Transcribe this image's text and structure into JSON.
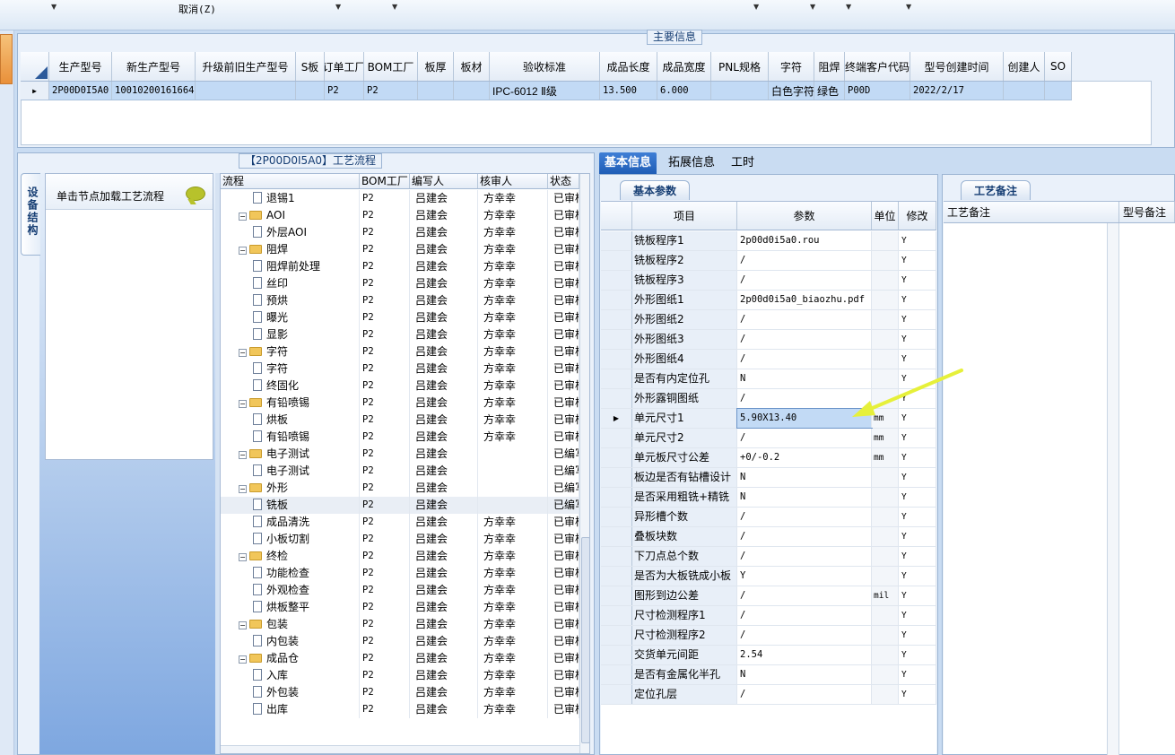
{
  "toolbar": {
    "cancel": "取消(Z)"
  },
  "main_info": {
    "title": "主要信息",
    "columns": [
      "生产型号",
      "新生产型号",
      "升级前旧生产型号",
      "S板",
      "订单工厂",
      "BOM工厂",
      "板厚",
      "板材",
      "验收标准",
      "成品长度",
      "成品宽度",
      "PNL规格",
      "字符",
      "阻焊",
      "终端客户代码",
      "型号创建时间",
      "创建人",
      "SO"
    ],
    "row": [
      "2P00D0I5A0",
      "10010200161664",
      "",
      "",
      "P2",
      "P2",
      "",
      "",
      "IPC-6012 Ⅱ级",
      "13.500",
      "6.000",
      "",
      "白色字符",
      "绿色",
      "P00D",
      "2022/2/17",
      "",
      ""
    ]
  },
  "left_panel": {
    "title": "【2P00D0I5A0】工艺流程",
    "vertical_tab": "设备结构",
    "node_hint": "单击节点加载工艺流程",
    "tree_columns": [
      "流程",
      "BOM工厂",
      "编写人",
      "核审人",
      "状态"
    ],
    "tree_rows": [
      {
        "name": "退锡1",
        "level": 1,
        "folder": false,
        "bom": "P2",
        "writer": "吕建会",
        "reviewer": "方幸幸",
        "status": "已审核"
      },
      {
        "name": "AOI",
        "level": 0,
        "folder": true,
        "bom": "P2",
        "writer": "吕建会",
        "reviewer": "方幸幸",
        "status": "已审核"
      },
      {
        "name": "外层AOI",
        "level": 1,
        "folder": false,
        "bom": "P2",
        "writer": "吕建会",
        "reviewer": "方幸幸",
        "status": "已审核"
      },
      {
        "name": "阻焊",
        "level": 0,
        "folder": true,
        "bom": "P2",
        "writer": "吕建会",
        "reviewer": "方幸幸",
        "status": "已审核"
      },
      {
        "name": "阻焊前处理",
        "level": 1,
        "folder": false,
        "bom": "P2",
        "writer": "吕建会",
        "reviewer": "方幸幸",
        "status": "已审核"
      },
      {
        "name": "丝印",
        "level": 1,
        "folder": false,
        "bom": "P2",
        "writer": "吕建会",
        "reviewer": "方幸幸",
        "status": "已审核"
      },
      {
        "name": "预烘",
        "level": 1,
        "folder": false,
        "bom": "P2",
        "writer": "吕建会",
        "reviewer": "方幸幸",
        "status": "已审核"
      },
      {
        "name": "曝光",
        "level": 1,
        "folder": false,
        "bom": "P2",
        "writer": "吕建会",
        "reviewer": "方幸幸",
        "status": "已审核"
      },
      {
        "name": "显影",
        "level": 1,
        "folder": false,
        "bom": "P2",
        "writer": "吕建会",
        "reviewer": "方幸幸",
        "status": "已审核"
      },
      {
        "name": "字符",
        "level": 0,
        "folder": true,
        "bom": "P2",
        "writer": "吕建会",
        "reviewer": "方幸幸",
        "status": "已审核"
      },
      {
        "name": "字符",
        "level": 1,
        "folder": false,
        "bom": "P2",
        "writer": "吕建会",
        "reviewer": "方幸幸",
        "status": "已审核"
      },
      {
        "name": "终固化",
        "level": 1,
        "folder": false,
        "bom": "P2",
        "writer": "吕建会",
        "reviewer": "方幸幸",
        "status": "已审核"
      },
      {
        "name": "有铅喷锡",
        "level": 0,
        "folder": true,
        "bom": "P2",
        "writer": "吕建会",
        "reviewer": "方幸幸",
        "status": "已审核"
      },
      {
        "name": "烘板",
        "level": 1,
        "folder": false,
        "bom": "P2",
        "writer": "吕建会",
        "reviewer": "方幸幸",
        "status": "已审核"
      },
      {
        "name": "有铅喷锡",
        "level": 1,
        "folder": false,
        "bom": "P2",
        "writer": "吕建会",
        "reviewer": "方幸幸",
        "status": "已审核"
      },
      {
        "name": "电子测试",
        "level": 0,
        "folder": true,
        "bom": "P2",
        "writer": "吕建会",
        "reviewer": "",
        "status": "已编写"
      },
      {
        "name": "电子测试",
        "level": 1,
        "folder": false,
        "bom": "P2",
        "writer": "吕建会",
        "reviewer": "",
        "status": "已编写"
      },
      {
        "name": "外形",
        "level": 0,
        "folder": true,
        "bom": "P2",
        "writer": "吕建会",
        "reviewer": "",
        "status": "已编写"
      },
      {
        "name": "铣板",
        "level": 1,
        "folder": false,
        "bom": "P2",
        "writer": "吕建会",
        "reviewer": "",
        "status": "已编写",
        "selected": true
      },
      {
        "name": "成品清洗",
        "level": 1,
        "folder": false,
        "bom": "P2",
        "writer": "吕建会",
        "reviewer": "方幸幸",
        "status": "已审核"
      },
      {
        "name": "小板切割",
        "level": 1,
        "folder": false,
        "bom": "P2",
        "writer": "吕建会",
        "reviewer": "方幸幸",
        "status": "已审核"
      },
      {
        "name": "终检",
        "level": 0,
        "folder": true,
        "bom": "P2",
        "writer": "吕建会",
        "reviewer": "方幸幸",
        "status": "已审核"
      },
      {
        "name": "功能检查",
        "level": 1,
        "folder": false,
        "bom": "P2",
        "writer": "吕建会",
        "reviewer": "方幸幸",
        "status": "已审核"
      },
      {
        "name": "外观检查",
        "level": 1,
        "folder": false,
        "bom": "P2",
        "writer": "吕建会",
        "reviewer": "方幸幸",
        "status": "已审核"
      },
      {
        "name": "烘板整平",
        "level": 1,
        "folder": false,
        "bom": "P2",
        "writer": "吕建会",
        "reviewer": "方幸幸",
        "status": "已审核"
      },
      {
        "name": "包装",
        "level": 0,
        "folder": true,
        "bom": "P2",
        "writer": "吕建会",
        "reviewer": "方幸幸",
        "status": "已审核"
      },
      {
        "name": "内包装",
        "level": 1,
        "folder": false,
        "bom": "P2",
        "writer": "吕建会",
        "reviewer": "方幸幸",
        "status": "已审核"
      },
      {
        "name": "成品仓",
        "level": 0,
        "folder": true,
        "bom": "P2",
        "writer": "吕建会",
        "reviewer": "方幸幸",
        "status": "已审核"
      },
      {
        "name": "入库",
        "level": 1,
        "folder": false,
        "bom": "P2",
        "writer": "吕建会",
        "reviewer": "方幸幸",
        "status": "已审核"
      },
      {
        "name": "外包装",
        "level": 1,
        "folder": false,
        "bom": "P2",
        "writer": "吕建会",
        "reviewer": "方幸幸",
        "status": "已审核"
      },
      {
        "name": "出库",
        "level": 1,
        "folder": false,
        "bom": "P2",
        "writer": "吕建会",
        "reviewer": "方幸幸",
        "status": "已审核"
      }
    ]
  },
  "right_tabs": [
    "基本信息",
    "拓展信息",
    "工时"
  ],
  "params": {
    "section": "基本参数",
    "columns": [
      "项目",
      "参数",
      "单位",
      "修改"
    ],
    "rows": [
      {
        "item": "铣板程序1",
        "value": "2p00d0i5a0.rou",
        "unit": "",
        "mod": "Y"
      },
      {
        "item": "铣板程序2",
        "value": "/",
        "unit": "",
        "mod": "Y"
      },
      {
        "item": "铣板程序3",
        "value": "/",
        "unit": "",
        "mod": "Y"
      },
      {
        "item": "外形图纸1",
        "value": "2p00d0i5a0_biaozhu.pdf",
        "unit": "",
        "mod": "Y"
      },
      {
        "item": "外形图纸2",
        "value": "/",
        "unit": "",
        "mod": "Y"
      },
      {
        "item": "外形图纸3",
        "value": "/",
        "unit": "",
        "mod": "Y"
      },
      {
        "item": "外形图纸4",
        "value": "/",
        "unit": "",
        "mod": "Y"
      },
      {
        "item": "是否有内定位孔",
        "value": "N",
        "unit": "",
        "mod": "Y"
      },
      {
        "item": "外形露铜图纸",
        "value": "/",
        "unit": "",
        "mod": "Y"
      },
      {
        "item": "单元尺寸1",
        "value": "5.90X13.40",
        "unit": "mm",
        "mod": "Y",
        "current": true
      },
      {
        "item": "单元尺寸2",
        "value": "/",
        "unit": "mm",
        "mod": "Y"
      },
      {
        "item": "单元板尺寸公差",
        "value": "+0/-0.2",
        "unit": "mm",
        "mod": "Y"
      },
      {
        "item": "板边是否有钻槽设计",
        "value": "N",
        "unit": "",
        "mod": "Y"
      },
      {
        "item": "是否采用粗铣+精铣",
        "value": "N",
        "unit": "",
        "mod": "Y"
      },
      {
        "item": "异形槽个数",
        "value": "/",
        "unit": "",
        "mod": "Y"
      },
      {
        "item": "叠板块数",
        "value": "/",
        "unit": "",
        "mod": "Y"
      },
      {
        "item": "下刀点总个数",
        "value": "/",
        "unit": "",
        "mod": "Y"
      },
      {
        "item": "是否为大板铣成小板",
        "value": "Y",
        "unit": "",
        "mod": "Y"
      },
      {
        "item": "图形到边公差",
        "value": "/",
        "unit": "mil",
        "mod": "Y"
      },
      {
        "item": "尺寸检测程序1",
        "value": "/",
        "unit": "",
        "mod": "Y"
      },
      {
        "item": "尺寸检测程序2",
        "value": "/",
        "unit": "",
        "mod": "Y"
      },
      {
        "item": "交货单元间距",
        "value": "2.54",
        "unit": "",
        "mod": "Y"
      },
      {
        "item": "是否有金属化半孔",
        "value": "N",
        "unit": "",
        "mod": "Y"
      },
      {
        "item": "定位孔层",
        "value": "/",
        "unit": "",
        "mod": "Y"
      }
    ]
  },
  "notes": {
    "section": "工艺备注",
    "columns": [
      "工艺备注",
      "型号备注"
    ]
  },
  "colors": {
    "accent": "#1f5db6",
    "highlight": "#c2daf5",
    "arrow": "#e6f03a"
  }
}
